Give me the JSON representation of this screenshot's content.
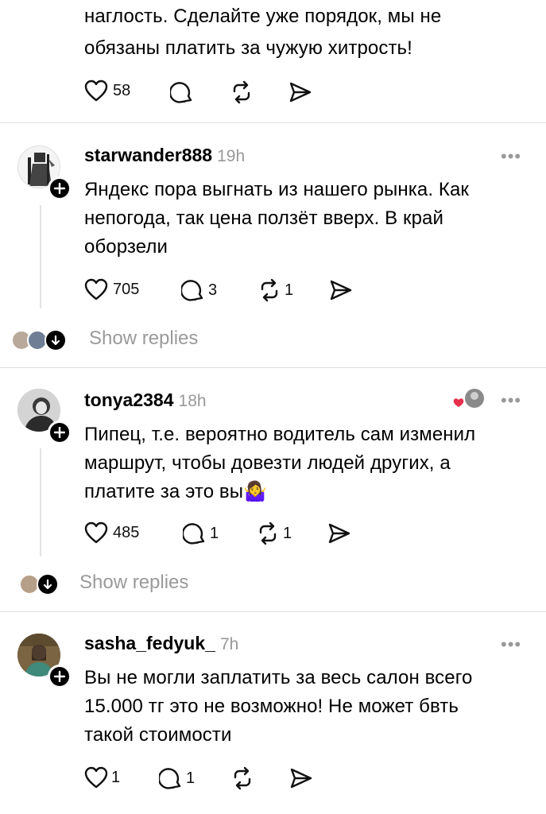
{
  "top_comment": {
    "text_line1": "наглость. Сделайте уже порядок, мы не",
    "text_line2": "обязаны платить за чужую хитрость!",
    "likes": "58"
  },
  "comments": [
    {
      "username": "starwander888",
      "time": "19h",
      "line1": "Яндекс пора выгнать из нашего рынка. Как",
      "line2": "непогода, так цена ползёт вверх. В край",
      "line3": "оборзели",
      "likes": "705",
      "replies": "3",
      "reposts": "1",
      "show_replies": "Show replies"
    },
    {
      "username": "tonya2384",
      "time": "18h",
      "line1": "Пипец, т.е. вероятно водитель сам изменил",
      "line2": "маршрут, чтобы довезти людей других, а",
      "line3": "платите за это вы🤷‍♀️",
      "likes": "485",
      "replies": "1",
      "reposts": "1",
      "show_replies": "Show replies"
    },
    {
      "username": "sasha_fedyuk_",
      "time": "7h",
      "line1": "Вы не могли заплатить за весь салон всего",
      "line2": "15.000 тг это не возможно! Не может бвть",
      "line3": "такой стоимости",
      "likes": "1",
      "replies": "1"
    }
  ],
  "icons": {
    "like": "heart-icon",
    "reply": "comment-bubble-icon",
    "repost": "repost-icon",
    "share": "send-icon",
    "more": "more-dots-icon",
    "follow": "plus-icon",
    "expand": "arrow-down-icon"
  },
  "more_glyph": "•••"
}
